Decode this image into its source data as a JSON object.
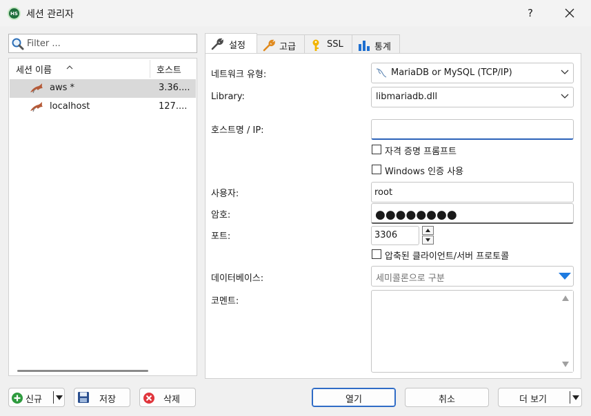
{
  "window": {
    "title": "세션 관리자",
    "app_icon_text": "HS",
    "help_label": "?"
  },
  "filter": {
    "placeholder": "Filter ..."
  },
  "session_list": {
    "columns": [
      "세션 이름",
      "호스트"
    ],
    "rows": [
      {
        "name": "aws *",
        "host": "3.36....",
        "selected": true
      },
      {
        "name": "localhost",
        "host": "127....",
        "selected": false
      }
    ]
  },
  "bottom_buttons": {
    "new_label": "신규",
    "save_label": "저장",
    "delete_label": "삭제",
    "open_label": "열기",
    "cancel_label": "취소",
    "more_label": "더 보기"
  },
  "tabs": [
    {
      "label": "설정",
      "icon": "wrench-icon",
      "active": true
    },
    {
      "label": "고급",
      "icon": "wrench-orange-icon",
      "active": false
    },
    {
      "label": "SSL",
      "icon": "key-icon",
      "active": false
    },
    {
      "label": "통계",
      "icon": "bar-chart-icon",
      "active": false
    }
  ],
  "settings": {
    "network_type_label": "네트워크 유형:",
    "network_type_value": "MariaDB or MySQL (TCP/IP)",
    "library_label": "Library:",
    "library_value": "libmariadb.dll",
    "host_label": "호스트명 / IP:",
    "host_value": "",
    "prompt_credentials_label": "자격 증명 프롬프트",
    "prompt_credentials_checked": false,
    "windows_auth_label": "Windows 인증 사용",
    "windows_auth_checked": false,
    "user_label": "사용자:",
    "user_value": "root",
    "password_label": "암호:",
    "password_mask": "●●●●●●●●",
    "port_label": "포트:",
    "port_value": "3306",
    "compressed_label": "압축된 클라이언트/서버 프로토콜",
    "compressed_checked": false,
    "database_label": "데이터베이스:",
    "database_placeholder": "세미콜론으로 구분",
    "comment_label": "코멘트:",
    "comment_value": ""
  },
  "colors": {
    "accent": "#2e6bc6",
    "selected_row": "#d9d9d9",
    "dropdown_arrow": "#1e7be0"
  }
}
